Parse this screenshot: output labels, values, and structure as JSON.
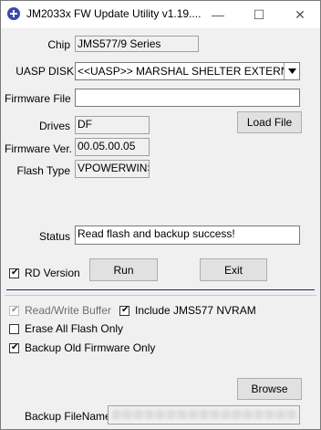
{
  "window": {
    "title": "JM2033x FW Update Utility v1.19....",
    "min_glyph": "—",
    "max_glyph": "☐",
    "close_glyph": "✕"
  },
  "chip": {
    "label": "Chip",
    "value": "JMS577/9 Series"
  },
  "uasp": {
    "label": "UASP DISK",
    "value": "<<UASP>> MARSHAL SHELTER EXTERNAL"
  },
  "firmware_file": {
    "label": "Firmware File",
    "value": ""
  },
  "load_file_label": "Load File",
  "drives": {
    "label": "Drives",
    "value": "DF"
  },
  "firmware_ver": {
    "label": "Firmware Ver.",
    "value": "00.05.00.05"
  },
  "flash_type": {
    "label": "Flash Type",
    "value": "VPOWERWINS"
  },
  "status": {
    "label": "Status",
    "value": "Read flash and backup success!"
  },
  "rd_version": {
    "label": "RD Version",
    "checked": true
  },
  "run_label": "Run",
  "exit_label": "Exit",
  "options": {
    "read_write_buffer": {
      "label": "Read/Write Buffer",
      "checked": true,
      "enabled": false
    },
    "include_nvram": {
      "label": "Include JMS577 NVRAM",
      "checked": true
    },
    "erase_all_flash": {
      "label": "Erase All Flash Only",
      "checked": false
    },
    "backup_old_fw": {
      "label": "Backup Old Firmware Only",
      "checked": true
    }
  },
  "browse_label": "Browse",
  "backup_filename": {
    "label": "Backup FileName"
  },
  "check_glyph": "✔",
  "icons": {
    "app": "usb-chip-icon",
    "dropdown": "chevron-down-icon"
  }
}
